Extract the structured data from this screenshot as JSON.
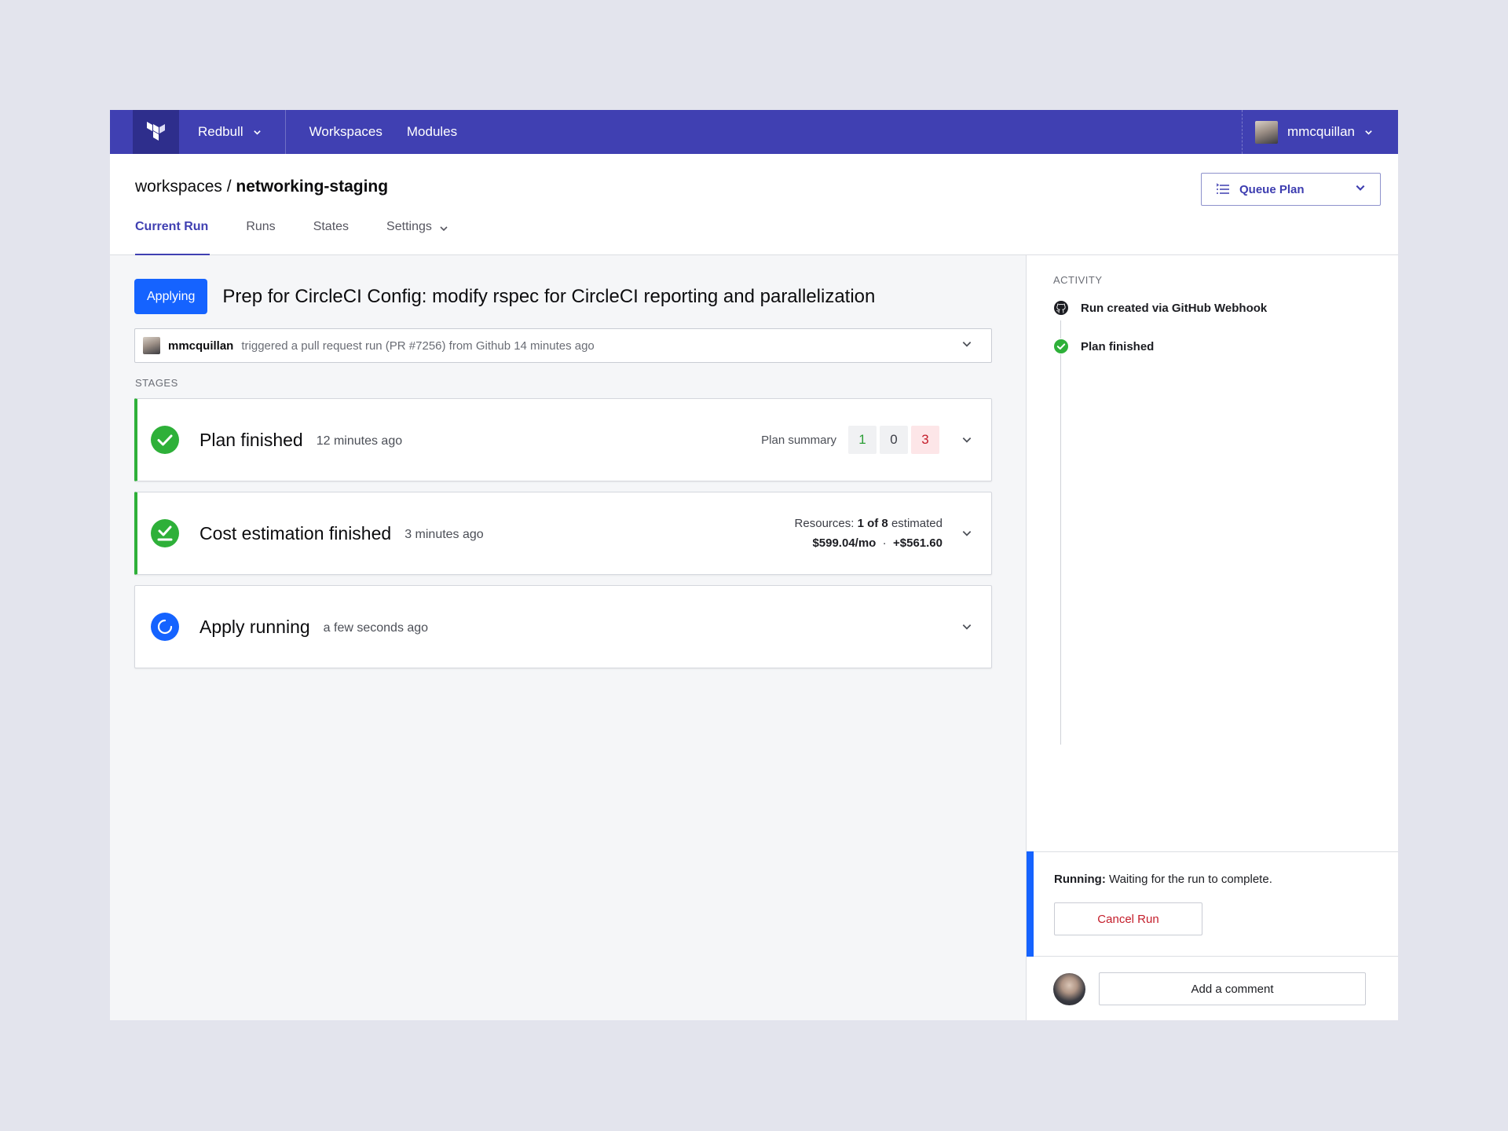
{
  "nav": {
    "org": "Redbull",
    "links": [
      "Workspaces",
      "Modules"
    ],
    "user": "mmcquillan"
  },
  "breadcrumb": {
    "root": "workspaces",
    "separator": "/",
    "workspace": "networking-staging"
  },
  "queue_plan": {
    "label": "Queue Plan"
  },
  "tabs": [
    "Current Run",
    "Runs",
    "States",
    "Settings"
  ],
  "run": {
    "status": "Applying",
    "title": "Prep for CircleCI Config: modify rspec for CircleCI reporting and parallelization",
    "trigger_user": "mmcquillan",
    "trigger_text": "triggered a pull request run (PR #7256) from Github 14 minutes ago"
  },
  "stages_label": "STAGES",
  "stages": {
    "plan": {
      "title": "Plan finished",
      "time": "12 minutes ago",
      "summary_label": "Plan summary",
      "add": "1",
      "change": "0",
      "destroy": "3"
    },
    "cost": {
      "title": "Cost estimation finished",
      "time": "3 minutes ago",
      "resources_prefix": "Resources:",
      "resources_count": "1 of 8",
      "resources_suffix": "estimated",
      "monthly": "$599.04/mo",
      "separator": "·",
      "delta": "+$561.60"
    },
    "apply": {
      "title": "Apply running",
      "time": "a few seconds ago"
    }
  },
  "activity": {
    "label": "ACTIVITY",
    "items": [
      {
        "text": "Run created via GitHub Webhook",
        "icon": "github-icon"
      },
      {
        "text": "Plan finished",
        "icon": "check-circle-icon"
      }
    ],
    "running_label": "Running:",
    "running_text": "Waiting for the run to complete.",
    "cancel": "Cancel Run",
    "comment": "Add a comment"
  },
  "colors": {
    "nav": "#4040b2",
    "accent": "#1563ff",
    "success": "#2eb039",
    "danger": "#c41d2a"
  }
}
